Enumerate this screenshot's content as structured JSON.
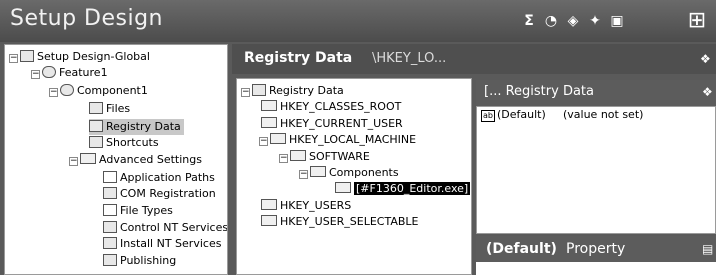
{
  "header": {
    "title": "Setup Design"
  },
  "left_tree": [
    {
      "label": "Setup Design-Global",
      "icon": "setup-global-icon"
    },
    {
      "label": "Feature1",
      "icon": "feature-icon"
    },
    {
      "label": "Component1",
      "icon": "component-icon"
    },
    {
      "label": "Files",
      "icon": "files-icon"
    },
    {
      "label": "Registry Data",
      "icon": "registry-icon"
    },
    {
      "label": "Shortcuts",
      "icon": "shortcut-icon"
    },
    {
      "label": "Advanced Settings",
      "icon": "folder-icon"
    },
    {
      "label": "Application Paths",
      "icon": "application-paths-icon"
    },
    {
      "label": "COM Registration",
      "icon": "com-icon"
    },
    {
      "label": "File Types",
      "icon": "file-types-icon"
    },
    {
      "label": "Control NT Services",
      "icon": "control-nt-icon"
    },
    {
      "label": "Install NT Services",
      "icon": "install-nt-icon"
    },
    {
      "label": "Publishing",
      "icon": "publishing-icon"
    }
  ],
  "middle": {
    "title": "Registry Data",
    "path": "\\HKEY_LO..."
  },
  "registry_tree": [
    {
      "label": "Registry Data"
    },
    {
      "label": "HKEY_CLASSES_ROOT"
    },
    {
      "label": "HKEY_CURRENT_USER"
    },
    {
      "label": "HKEY_LOCAL_MACHINE"
    },
    {
      "label": "SOFTWARE"
    },
    {
      "label": "Components"
    },
    {
      "label": "[#F1360_Editor.exe]"
    },
    {
      "label": "HKEY_USERS"
    },
    {
      "label": "HKEY_USER_SELECTABLE"
    }
  ],
  "values_panel": {
    "title": "[... Registry Data",
    "rows": [
      {
        "name": "(Default)",
        "value": "(value not set)"
      }
    ]
  },
  "property_panel": {
    "title_bold": "(Default)",
    "title_rest": "Property"
  }
}
